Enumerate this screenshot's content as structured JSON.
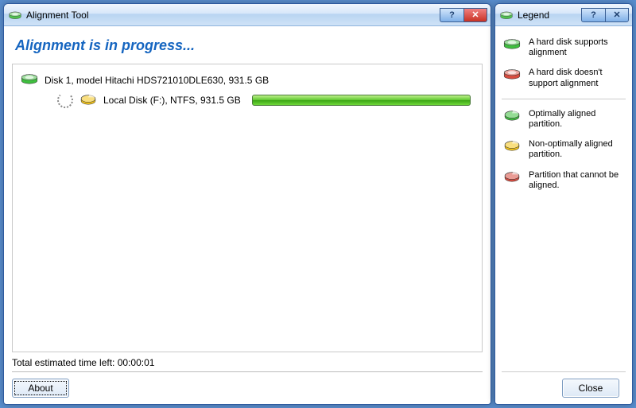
{
  "main_window": {
    "title": "Alignment Tool",
    "heading": "Alignment is in progress...",
    "disk": {
      "label": "Disk 1, model Hitachi HDS721010DLE630, 931.5 GB",
      "partition": {
        "label": "Local Disk (F:), NTFS, 931.5 GB",
        "progress_percent": 100
      }
    },
    "status": "Total estimated time left: 00:00:01",
    "about_button": "About"
  },
  "legend_window": {
    "title": "Legend",
    "items": [
      {
        "icon": "disk-green",
        "text": "A hard disk supports alignment"
      },
      {
        "icon": "disk-red",
        "text": "A hard disk doesn't support alignment"
      },
      {
        "sep": true
      },
      {
        "icon": "part-green",
        "text": "Optimally aligned partition."
      },
      {
        "icon": "part-yellow",
        "text": "Non-optimally aligned partition."
      },
      {
        "icon": "part-red",
        "text": "Partition that cannot be aligned."
      }
    ],
    "close_button": "Close"
  }
}
